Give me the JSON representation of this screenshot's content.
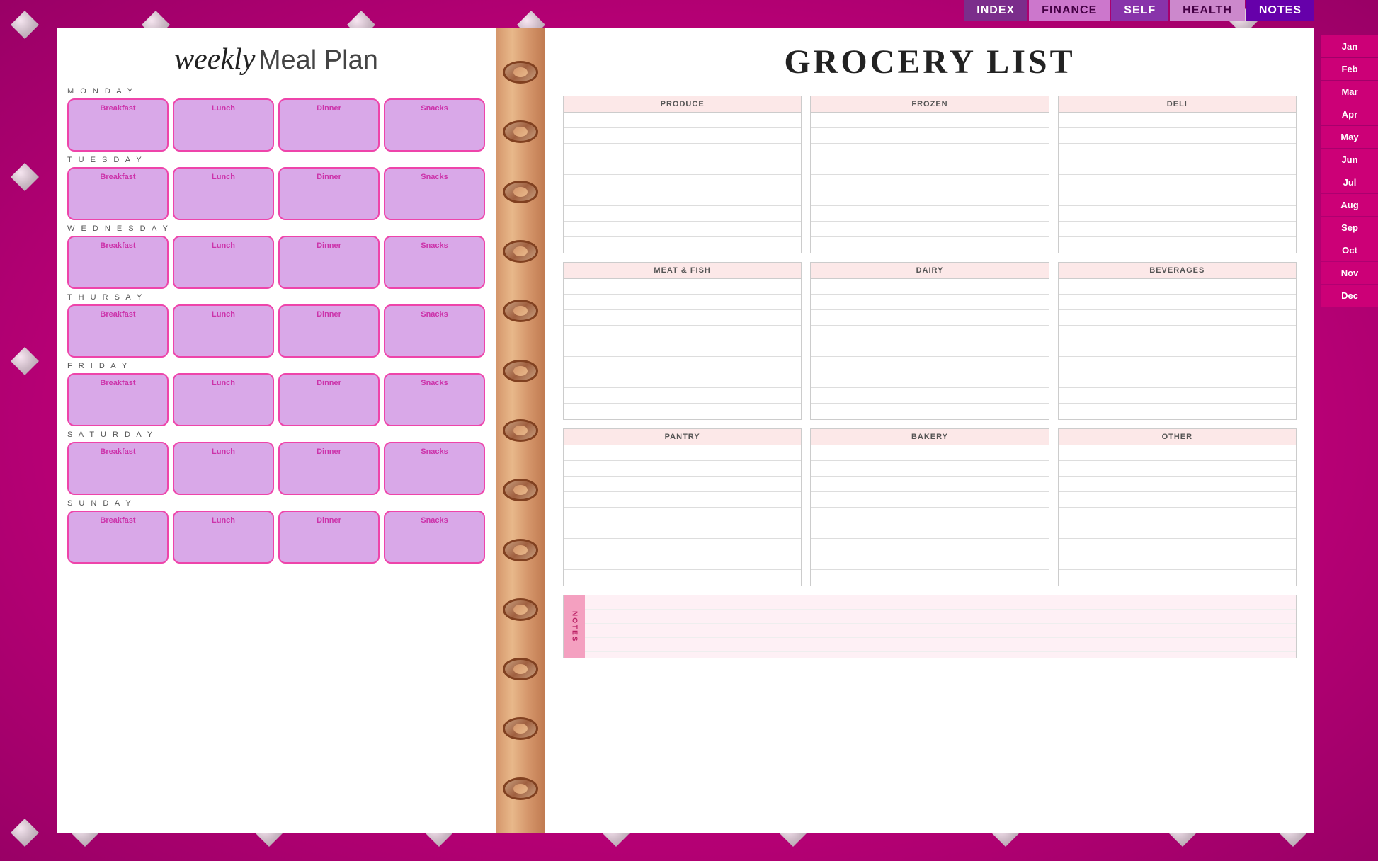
{
  "nav": {
    "tabs": [
      {
        "id": "index",
        "label": "INDEX",
        "class": "nav-tab-index"
      },
      {
        "id": "finance",
        "label": "FINANCE",
        "class": "nav-tab-finance"
      },
      {
        "id": "self",
        "label": "SELF",
        "class": "nav-tab-self"
      },
      {
        "id": "health",
        "label": "HEALTH",
        "class": "nav-tab-health"
      },
      {
        "id": "notes",
        "label": "NOTES",
        "class": "nav-tab-notes"
      }
    ]
  },
  "months": [
    "Jan",
    "Feb",
    "Mar",
    "Apr",
    "May",
    "Jun",
    "Jul",
    "Aug",
    "Sep",
    "Oct",
    "Nov",
    "Dec"
  ],
  "left_page": {
    "title_cursive": "weekly",
    "title_regular": "Meal Plan",
    "days": [
      {
        "label": "M O N D A Y"
      },
      {
        "label": "T U E S D A Y"
      },
      {
        "label": "W E D N E S D A Y"
      },
      {
        "label": "T H U R S A Y"
      },
      {
        "label": "F R I D A Y"
      },
      {
        "label": "S A T U R D A Y"
      },
      {
        "label": "S U N D A Y"
      }
    ],
    "meal_types": [
      "Breakfast",
      "Lunch",
      "Dinner",
      "Snacks"
    ]
  },
  "right_page": {
    "title": "GROCERY LIST",
    "sections_row1": [
      {
        "header": "PRODUCE",
        "lines": 9
      },
      {
        "header": "FROZEN",
        "lines": 9
      },
      {
        "header": "DELI",
        "lines": 9
      }
    ],
    "sections_row2": [
      {
        "header": "MEAT & FISH",
        "lines": 9
      },
      {
        "header": "DAIRY",
        "lines": 9
      },
      {
        "header": "BEVERAGES",
        "lines": 9
      }
    ],
    "sections_row3": [
      {
        "header": "PANTRY",
        "lines": 9
      },
      {
        "header": "BAKERY",
        "lines": 9
      },
      {
        "header": "OTHER",
        "lines": 9
      }
    ],
    "notes_label": "NOTES"
  }
}
